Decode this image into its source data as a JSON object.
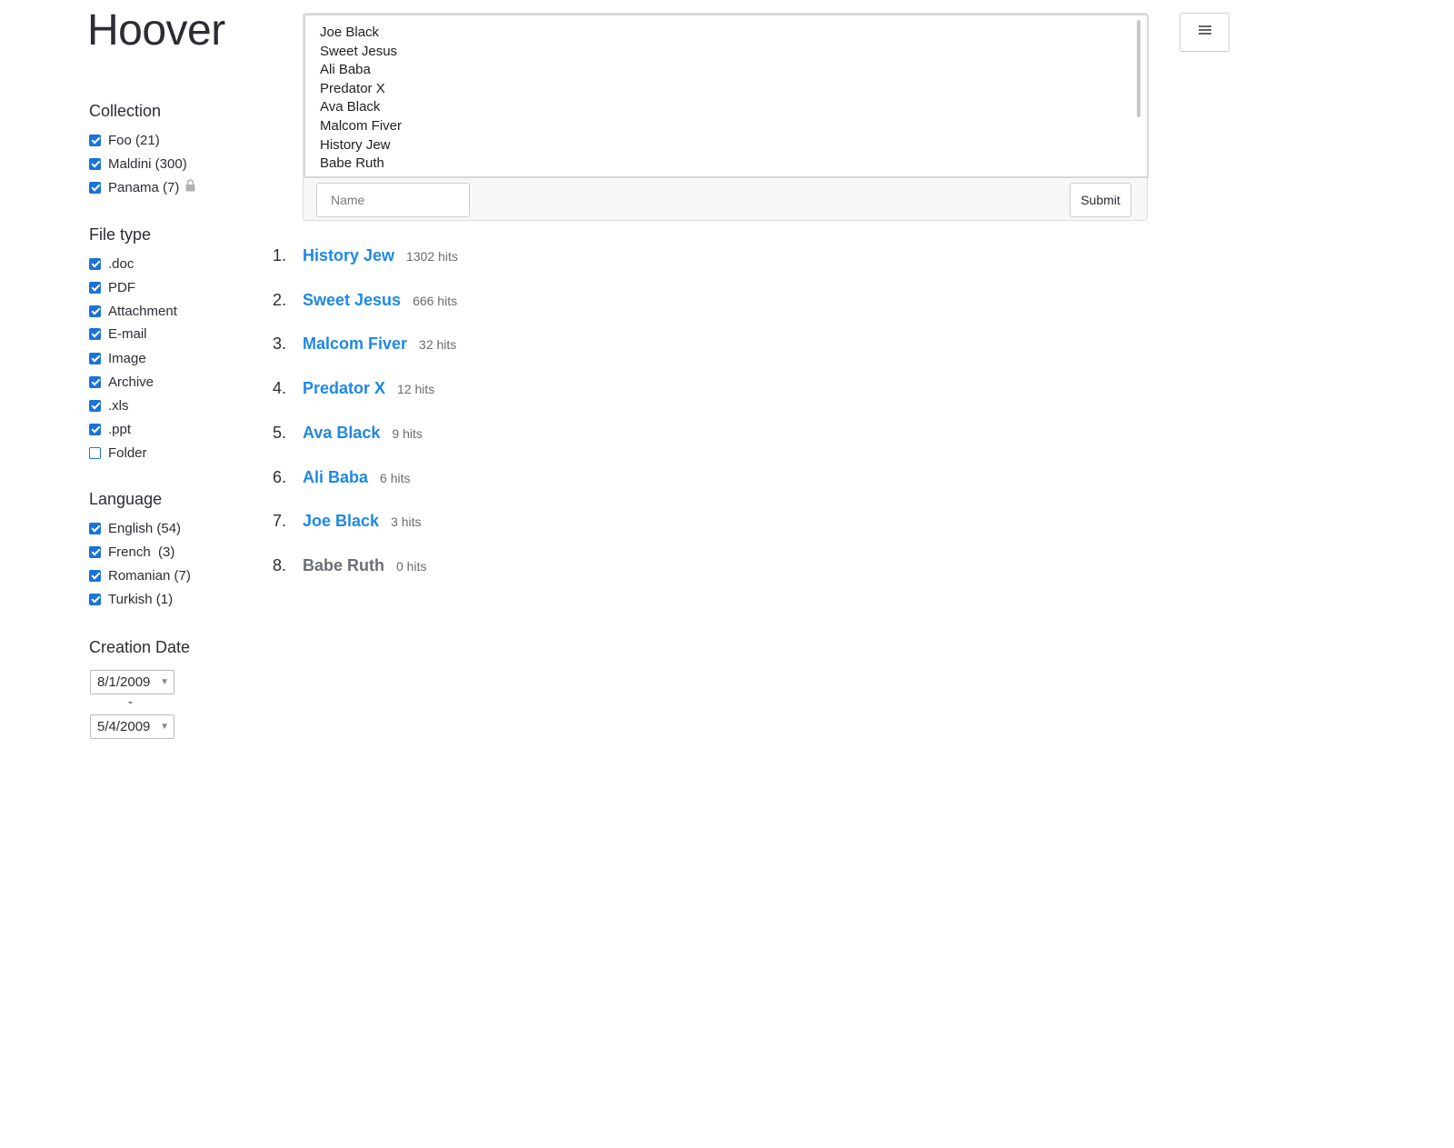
{
  "app": {
    "title": "Hoover"
  },
  "sidebar": {
    "collection": {
      "heading": "Collection",
      "options": [
        {
          "label": "Foo (21)",
          "checked": true
        },
        {
          "label": "Maldini (300)",
          "checked": true
        },
        {
          "label": "Panama (7)",
          "checked": true,
          "icon": "lock-icon"
        }
      ]
    },
    "file_type": {
      "heading": "File type",
      "options": [
        {
          "label": ".doc",
          "checked": true
        },
        {
          "label": "PDF",
          "checked": true
        },
        {
          "label": "Attachment",
          "checked": true
        },
        {
          "label": "E-mail",
          "checked": true
        },
        {
          "label": "Image",
          "checked": true
        },
        {
          "label": "Archive",
          "checked": true
        },
        {
          "label": ".xls",
          "checked": true
        },
        {
          "label": ".ppt",
          "checked": true
        },
        {
          "label": "Folder",
          "checked": false
        }
      ]
    },
    "language": {
      "heading": "Language",
      "options": [
        {
          "label": "English (54)",
          "checked": true
        },
        {
          "label": "French  (3)",
          "checked": true
        },
        {
          "label": "Romanian (7)",
          "checked": true
        },
        {
          "label": "Turkish (1)",
          "checked": true
        }
      ]
    },
    "creation_date": {
      "heading": "Creation Date",
      "from": "8/1/2009",
      "separator": "-",
      "to": "5/4/2009"
    }
  },
  "search": {
    "suggestions": [
      "Joe Black",
      "Sweet Jesus",
      "Ali Baba",
      "Predator X",
      "Ava Black",
      "Malcom Fiver",
      "History Jew",
      "Babe Ruth"
    ],
    "name_placeholder": "Name",
    "name_value": "",
    "submit_label": "Submit"
  },
  "header": {
    "menu_icon": "hamburger-menu-icon"
  },
  "results": [
    {
      "rank": "1.",
      "name": "History Jew",
      "hits": "1302 hits",
      "active": true
    },
    {
      "rank": "2.",
      "name": "Sweet Jesus",
      "hits": "666 hits",
      "active": true
    },
    {
      "rank": "3.",
      "name": "Malcom Fiver",
      "hits": "32 hits",
      "active": true
    },
    {
      "rank": "4.",
      "name": "Predator X",
      "hits": "12 hits",
      "active": true
    },
    {
      "rank": "5.",
      "name": "Ava Black",
      "hits": "9 hits",
      "active": true
    },
    {
      "rank": "6.",
      "name": "Ali Baba",
      "hits": "6 hits",
      "active": true
    },
    {
      "rank": "7.",
      "name": "Joe Black",
      "hits": "3 hits",
      "active": true
    },
    {
      "rank": "8.",
      "name": "Babe Ruth",
      "hits": "0 hits",
      "active": false
    }
  ],
  "colors": {
    "accent": "#1e88e5",
    "checkbox": "#1a73d9",
    "muted_link": "#6b7075",
    "text": "#2b2d33"
  }
}
